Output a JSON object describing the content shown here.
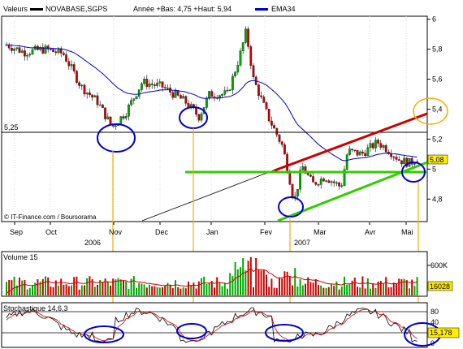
{
  "header": {
    "valeurs_label": "Valeurs",
    "symbol": "NOVABASE,SGPS",
    "annee_text": "Année +Bas: 4,75 +Haut: 5,94",
    "ema_label": "EMA34"
  },
  "price_panel": {
    "ylim": [
      4.65,
      6.02
    ],
    "yticks": [
      "4,8",
      "5",
      "5,2",
      "5,4",
      "5,6",
      "5,8",
      "6"
    ],
    "hline_label": "5,25",
    "last_label": "5,08",
    "watermark": "© IT-Finance.com / Boursorama"
  },
  "xaxis": {
    "months": [
      "Sep",
      "Oct",
      "Nov",
      "Dec",
      "Jan",
      "Fev",
      "Mar",
      "Avr",
      "Mai"
    ],
    "years": [
      "2006",
      "2007"
    ]
  },
  "volume_panel": {
    "title": "Volume 15",
    "tick_label": "600K",
    "last_label": "16028"
  },
  "stoch_panel": {
    "title": "Stochastique 14,6,3",
    "ticks": [
      "80",
      "40",
      "20",
      "0"
    ],
    "last_label": "15,178"
  },
  "colors": {
    "up": "#00aa00",
    "down": "#cc0000",
    "ema": "#0000cc",
    "channel_top": "#cc0000",
    "channel_bottom": "#33cc00",
    "support": "#33cc00",
    "circle": "#0000cc",
    "target_circle": "#f0b000",
    "marker_line": "#f0b000",
    "last_box": "#ffee00"
  },
  "chart_data": {
    "type": "candlestick",
    "title": "NOVABASE,SGPS",
    "ylim": [
      4.65,
      6.02
    ],
    "x_months": [
      "Sep",
      "Oct",
      "Nov",
      "Dec",
      "Jan",
      "Fev",
      "Mar",
      "Avr",
      "Mai"
    ],
    "price_keypoints": [
      {
        "x": "Sep",
        "y": 5.82
      },
      {
        "x": "Oct",
        "y": 5.78
      },
      {
        "x": "Nov",
        "y": 5.28
      },
      {
        "x": "Dec",
        "y": 5.55
      },
      {
        "x": "Jan",
        "y": 5.55
      },
      {
        "x": "Jan",
        "y": 5.92
      },
      {
        "x": "Fev",
        "y": 5.02
      },
      {
        "x": "Mar",
        "y": 4.85
      },
      {
        "x": "Avr",
        "y": 5.18
      },
      {
        "x": "Mai",
        "y": 5.08
      }
    ],
    "annotations": [
      {
        "type": "hline",
        "y": 5.25,
        "label": "5,25"
      },
      {
        "type": "support",
        "y": 5.01
      },
      {
        "type": "target",
        "y": 5.4
      },
      {
        "type": "last",
        "y": 5.08,
        "label": "5,08"
      }
    ],
    "stochastic_last": 15.178,
    "volume_last": 16028
  }
}
